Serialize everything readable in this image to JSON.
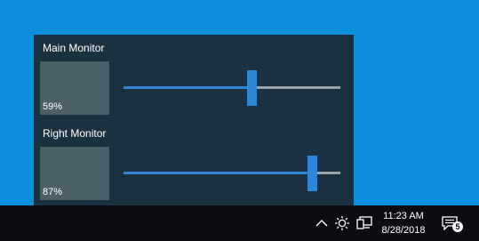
{
  "monitors": [
    {
      "label": "Main Monitor",
      "brightness_text": "59%",
      "brightness": 59
    },
    {
      "label": "Right Monitor",
      "brightness_text": "87%",
      "brightness": 87
    }
  ],
  "taskbar": {
    "time": "11:23 AM",
    "date": "8/28/2018",
    "notification_count": "5",
    "icons": [
      "chevron-up-icon",
      "brightness-icon",
      "network-icon",
      "action-center-icon"
    ]
  },
  "colors": {
    "desktop": "#0c8fdd",
    "flyout": "#1c313f",
    "accent": "#2f86d6",
    "track": "#9aa3a7",
    "taskbar": "#0b0d12"
  }
}
